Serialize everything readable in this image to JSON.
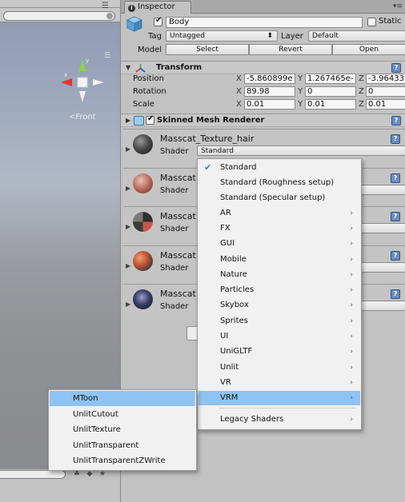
{
  "scene": {
    "front_label": "Front",
    "gizmo_label_text": "<"
  },
  "inspector": {
    "tab_title": "Inspector",
    "object": {
      "name": "Body",
      "active": true,
      "static_label": "Static",
      "tag_label": "Tag",
      "tag_value": "Untagged",
      "layer_label": "Layer",
      "layer_value": "Default",
      "model_label": "Model",
      "model_buttons": [
        "Select",
        "Revert",
        "Open"
      ]
    },
    "transform": {
      "title": "Transform",
      "rows": [
        {
          "label": "Position",
          "x": "-5.860899e",
          "y": "1.267465e-",
          "z": "-3.96433"
        },
        {
          "label": "Rotation",
          "x": "89.98",
          "y": "0",
          "z": "0"
        },
        {
          "label": "Scale",
          "x": "0.01",
          "y": "0.01",
          "z": "0.01"
        }
      ],
      "axes": [
        "X",
        "Y",
        "Z"
      ]
    },
    "skinned_mesh_renderer": {
      "title": "Skinned Mesh Renderer",
      "enabled": true
    },
    "materials": [
      {
        "name": "Masscat_Texture_hair",
        "shader_label": "Shader",
        "shader_value": "Standard"
      },
      {
        "name": "Masscat",
        "shader_label": "Shader",
        "shader_value": ""
      },
      {
        "name": "Masscat",
        "shader_label": "Shader",
        "shader_value": ""
      },
      {
        "name": "Masscat",
        "shader_label": "Shader",
        "shader_value": ""
      },
      {
        "name": "Masscat",
        "shader_label": "Shader",
        "shader_value": ""
      }
    ]
  },
  "shader_menu": {
    "items": [
      {
        "label": "Standard",
        "checked": true,
        "submenu": false
      },
      {
        "label": "Standard (Roughness setup)",
        "checked": false,
        "submenu": false
      },
      {
        "label": "Standard (Specular setup)",
        "checked": false,
        "submenu": false
      },
      {
        "label": "AR",
        "checked": false,
        "submenu": true
      },
      {
        "label": "FX",
        "checked": false,
        "submenu": true
      },
      {
        "label": "GUI",
        "checked": false,
        "submenu": true
      },
      {
        "label": "Mobile",
        "checked": false,
        "submenu": true
      },
      {
        "label": "Nature",
        "checked": false,
        "submenu": true
      },
      {
        "label": "Particles",
        "checked": false,
        "submenu": true
      },
      {
        "label": "Skybox",
        "checked": false,
        "submenu": true
      },
      {
        "label": "Sprites",
        "checked": false,
        "submenu": true
      },
      {
        "label": "UI",
        "checked": false,
        "submenu": true
      },
      {
        "label": "UniGLTF",
        "checked": false,
        "submenu": true
      },
      {
        "label": "Unlit",
        "checked": false,
        "submenu": true
      },
      {
        "label": "VR",
        "checked": false,
        "submenu": true
      },
      {
        "label": "VRM",
        "checked": false,
        "submenu": true,
        "highlighted": true
      },
      {
        "label": "Legacy Shaders",
        "checked": false,
        "submenu": true
      }
    ],
    "check_glyph": "✔",
    "arrow_glyph": "›"
  },
  "vrm_submenu": {
    "items": [
      {
        "label": "MToon",
        "highlighted": true
      },
      {
        "label": "UnlitCutout"
      },
      {
        "label": "UnlitTexture"
      },
      {
        "label": "UnlitTransparent"
      },
      {
        "label": "UnlitTransparentZWrite"
      }
    ]
  },
  "colors": {
    "menu_highlight": "#8ec3f2",
    "help_icon": "#6b8cc0",
    "gizmo_x": "#e0362c",
    "gizmo_y": "#8cd24a",
    "scene_sky": "#9ea9bd"
  }
}
